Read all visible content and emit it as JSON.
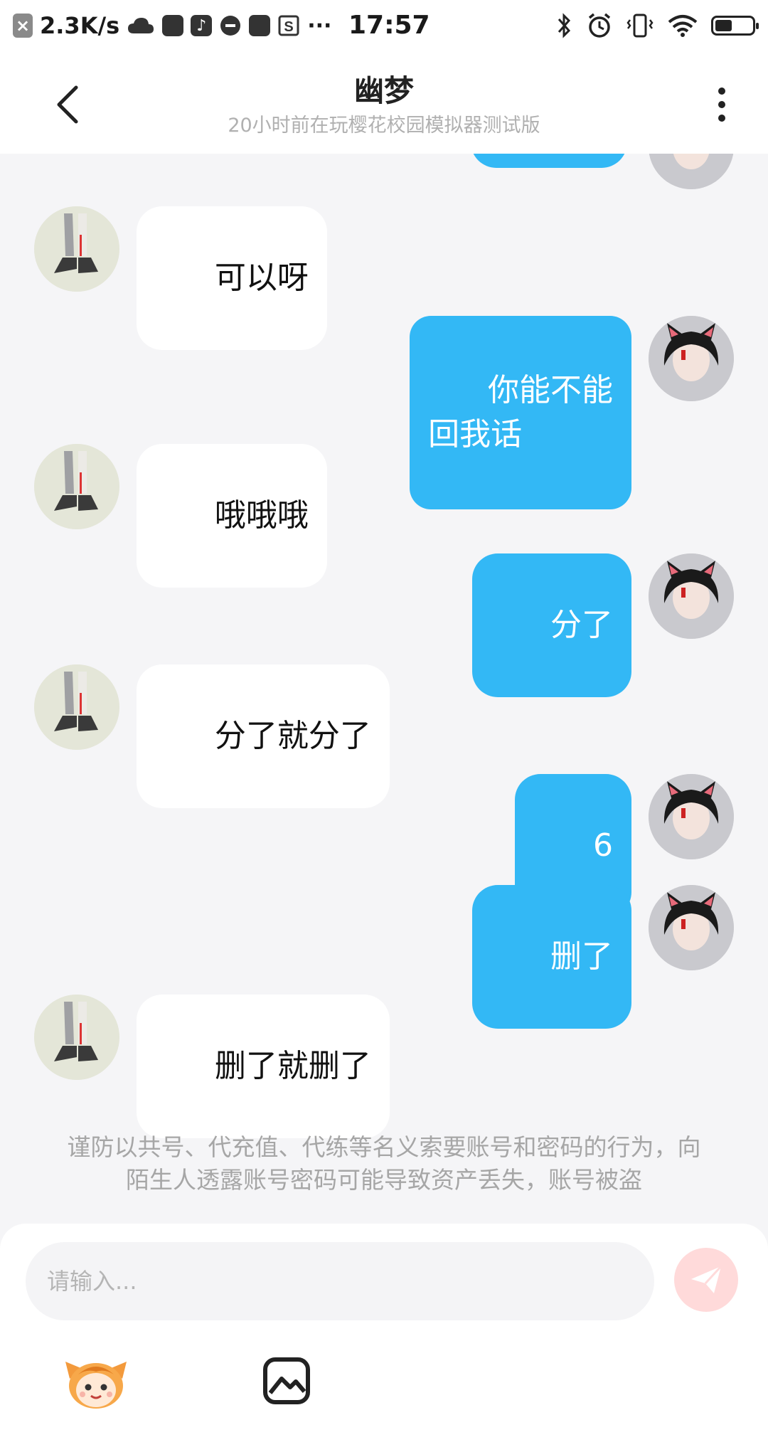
{
  "status_bar": {
    "x_badge": "×",
    "network_speed": "2.3K/s",
    "dots": "···",
    "time": "17:57",
    "battery_level": 0.45
  },
  "header": {
    "title": "幽梦",
    "subtitle": "20小时前在玩樱花校园模拟器测试版"
  },
  "messages": [
    {
      "from": "self",
      "text": ""
    },
    {
      "from": "other",
      "text": "可以呀"
    },
    {
      "from": "self",
      "text": "你能不能\n回我话"
    },
    {
      "from": "other",
      "text": "哦哦哦"
    },
    {
      "from": "self",
      "text": "分了"
    },
    {
      "from": "other",
      "text": "分了就分了"
    },
    {
      "from": "self",
      "text": "6"
    },
    {
      "from": "self",
      "text": "删了"
    },
    {
      "from": "other",
      "text": "删了就删了"
    }
  ],
  "notice": "谨防以共号、代充值、代练等名义索要账号和密码的行为，向陌生人透露账号密码可能导致资产丢失，账号被盗",
  "input": {
    "placeholder": "请输入..."
  },
  "colors": {
    "self_bubble": "#33b8f5",
    "other_bubble": "#ffffff",
    "send_button": "#ffdada",
    "background": "#f5f5f7"
  }
}
